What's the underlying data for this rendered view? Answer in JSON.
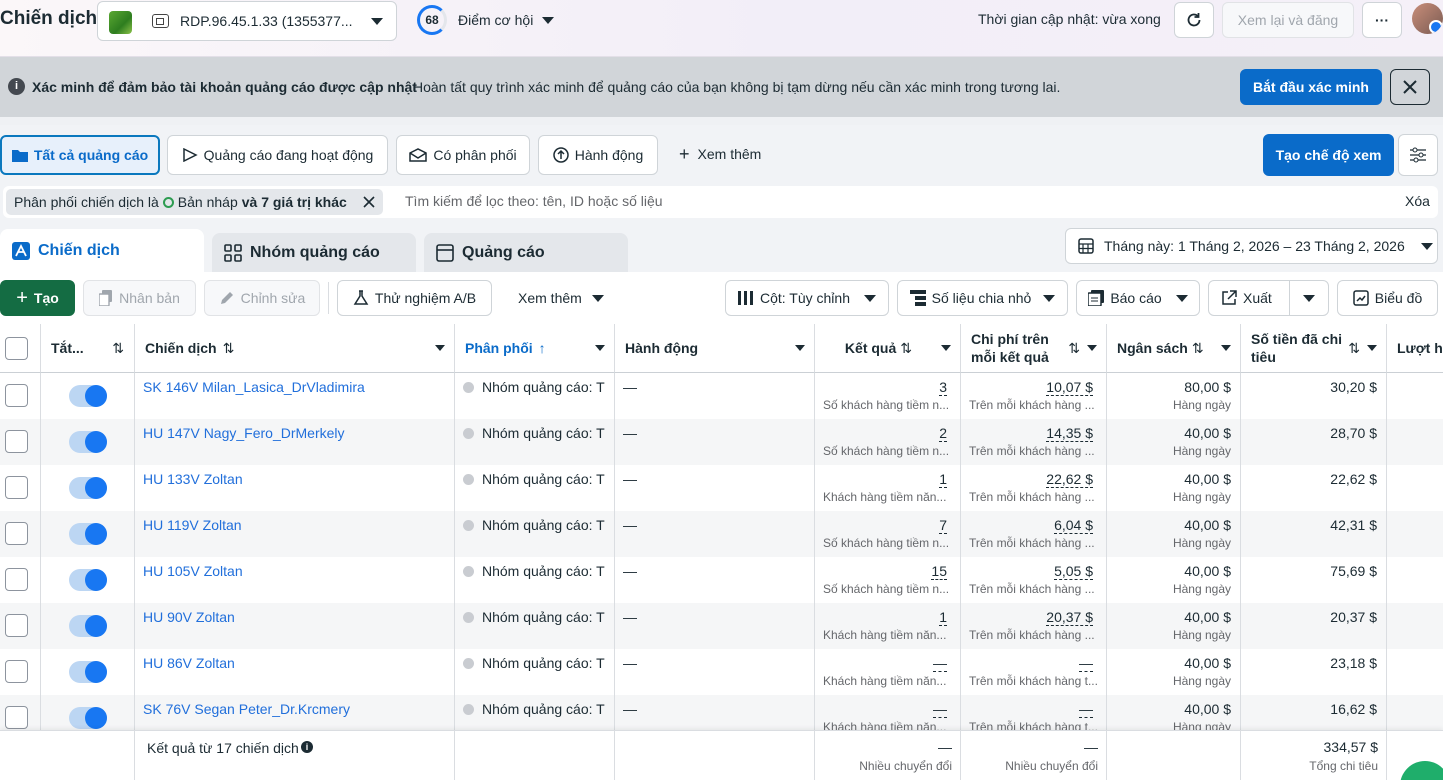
{
  "header": {
    "title": "Chiến dịch",
    "account_name": "RDP.96.45.1.33 (1355377...",
    "score": "68",
    "score_label": "Điểm cơ hội",
    "update_time": "Thời gian cập nhật: vừa xong",
    "review_publish": "Xem lại và đăng",
    "more": "···"
  },
  "banner": {
    "title": "Xác minh để đảm bảo tài khoản quảng cáo được cập nhật",
    "text": "Hoàn tất quy trình xác minh để quảng cáo của bạn không bị tạm dừng nếu cần xác minh trong tương lai.",
    "button": "Bắt đầu xác minh"
  },
  "filters": {
    "tabs": [
      "Tất cả quảng cáo",
      "Quảng cáo đang hoạt động",
      "Có phân phối",
      "Hành động"
    ],
    "see_more": "Xem thêm",
    "create_view": "Tạo chế độ xem",
    "chip_prefix": "Phân phối chiến dịch là",
    "chip_value": "Bản nháp",
    "chip_suffix": "và 7 giá trị khác",
    "search_placeholder": "Tìm kiếm để lọc theo: tên, ID hoặc số liệu",
    "clear": "Xóa"
  },
  "levels": {
    "campaigns": "Chiến dịch",
    "adsets": "Nhóm quảng cáo",
    "ads": "Quảng cáo",
    "date_range": "Tháng này: 1 Tháng 2, 2026 – 23 Tháng 2, 2026"
  },
  "toolbar": {
    "create": "Tạo",
    "duplicate": "Nhân bản",
    "edit": "Chỉnh sửa",
    "ab_test": "Thử nghiệm A/B",
    "see_more": "Xem thêm",
    "columns": "Cột: Tùy chỉnh",
    "breakdown": "Số liệu chia nhỏ",
    "reports": "Báo cáo",
    "export": "Xuất",
    "charts": "Biểu đồ"
  },
  "columns": {
    "toggle": "Tắt...",
    "campaign": "Chiến dịch",
    "delivery": "Phân phối",
    "actions": "Hành động",
    "results": "Kết quả",
    "cost_per_result_1": "Chi phí trên",
    "cost_per_result_2": "mỗi kết quả",
    "budget": "Ngân sách",
    "spent_1": "Số tiền đã chi",
    "spent_2": "tiêu",
    "reach": "Lượt hi"
  },
  "rows": [
    {
      "name": "SK 146V Milan_Lasica_DrVladimira",
      "delivery": "Nhóm quảng cáo: T",
      "action": "—",
      "result": "3",
      "result_sub": "Số khách hàng tiềm n...",
      "cpr": "10,07 $",
      "cpr_sub": "Trên mỗi khách hàng ...",
      "budget": "80,00 $",
      "budget_sub": "Hàng ngày",
      "spent": "30,20 $"
    },
    {
      "name": "HU 147V Nagy_Fero_DrMerkely",
      "delivery": "Nhóm quảng cáo: T",
      "action": "—",
      "result": "2",
      "result_sub": "Số khách hàng tiềm n...",
      "cpr": "14,35 $",
      "cpr_sub": "Trên mỗi khách hàng ...",
      "budget": "40,00 $",
      "budget_sub": "Hàng ngày",
      "spent": "28,70 $"
    },
    {
      "name": "HU 133V Zoltan",
      "delivery": "Nhóm quảng cáo: T",
      "action": "—",
      "result": "1",
      "result_sub": "Khách hàng tiềm năn...",
      "cpr": "22,62 $",
      "cpr_sub": "Trên mỗi khách hàng ...",
      "budget": "40,00 $",
      "budget_sub": "Hàng ngày",
      "spent": "22,62 $"
    },
    {
      "name": "HU 119V Zoltan",
      "delivery": "Nhóm quảng cáo: T",
      "action": "—",
      "result": "7",
      "result_sub": "Số khách hàng tiềm n...",
      "cpr": "6,04 $",
      "cpr_sub": "Trên mỗi khách hàng ...",
      "budget": "40,00 $",
      "budget_sub": "Hàng ngày",
      "spent": "42,31 $"
    },
    {
      "name": "HU 105V Zoltan",
      "delivery": "Nhóm quảng cáo: T",
      "action": "—",
      "result": "15",
      "result_sub": "Số khách hàng tiềm n...",
      "cpr": "5,05 $",
      "cpr_sub": "Trên mỗi khách hàng ...",
      "budget": "40,00 $",
      "budget_sub": "Hàng ngày",
      "spent": "75,69 $"
    },
    {
      "name": "HU 90V Zoltan",
      "delivery": "Nhóm quảng cáo: T",
      "action": "—",
      "result": "1",
      "result_sub": "Khách hàng tiềm năn...",
      "cpr": "20,37 $",
      "cpr_sub": "Trên mỗi khách hàng ...",
      "budget": "40,00 $",
      "budget_sub": "Hàng ngày",
      "spent": "20,37 $"
    },
    {
      "name": "HU 86V Zoltan",
      "delivery": "Nhóm quảng cáo: T",
      "action": "—",
      "result": "—",
      "result_sub": "Khách hàng tiềm năn...",
      "cpr": "—",
      "cpr_sub": "Trên mỗi khách hàng t...",
      "budget": "40,00 $",
      "budget_sub": "Hàng ngày",
      "spent": "23,18 $"
    },
    {
      "name": "SK 76V Segan Peter_Dr.Krcmery",
      "delivery": "Nhóm quảng cáo: T",
      "action": "—",
      "result": "—",
      "result_sub": "Khách hàng tiềm năn...",
      "cpr": "—",
      "cpr_sub": "Trên mỗi khách hàng t...",
      "budget": "40,00 $",
      "budget_sub": "Hàng ngày",
      "spent": "16,62 $"
    }
  ],
  "footer": {
    "label": "Kết quả từ 17 chiến dịch",
    "result": "—",
    "result_sub": "Nhiều chuyển đổi",
    "cpr": "—",
    "cpr_sub": "Nhiều chuyển đổi",
    "spent": "334,57 $",
    "spent_sub": "Tổng chi tiêu"
  }
}
